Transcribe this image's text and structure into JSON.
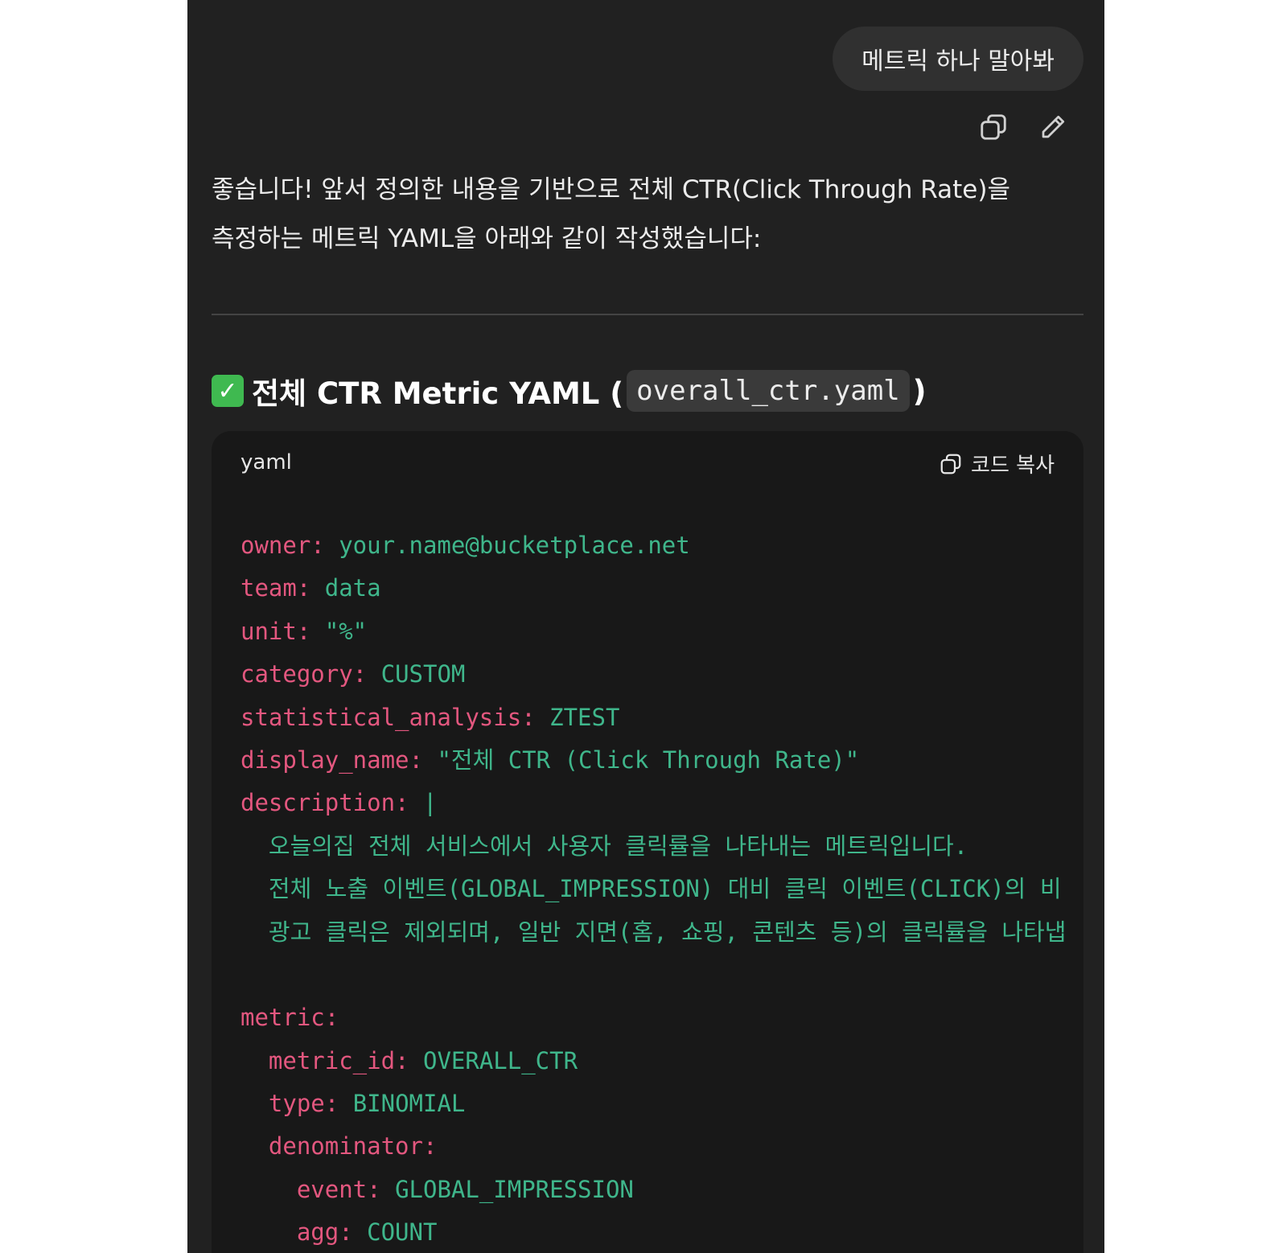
{
  "user_message": {
    "text": "메트릭 하나 말아봐"
  },
  "message_actions": {
    "copy_icon": "copy-icon",
    "edit_icon": "pencil-icon"
  },
  "assistant": {
    "intro_line1": "좋습니다! 앞서 정의한 내용을 기반으로 전체 CTR(Click Through Rate)을",
    "intro_line2": "측정하는 메트릭 YAML을 아래와 같이 작성했습니다:"
  },
  "section": {
    "heading_prefix": "전체 CTR Metric YAML (",
    "filename": "overall_ctr.yaml",
    "heading_suffix": ")"
  },
  "code_block": {
    "language": "yaml",
    "copy_label": "코드 복사",
    "lines": [
      {
        "key": "owner: ",
        "value": "your.name@bucketplace.net"
      },
      {
        "key": "team: ",
        "value": "data"
      },
      {
        "key": "unit: ",
        "value": "\"%\""
      },
      {
        "key": "category: ",
        "value": "CUSTOM"
      },
      {
        "key": "statistical_analysis: ",
        "value": "ZTEST"
      },
      {
        "key": "display_name: ",
        "value": "\"전체 CTR (Click Through Rate)\""
      },
      {
        "key": "description: ",
        "value": "|"
      },
      {
        "key": "",
        "value": "  오늘의집 전체 서비스에서 사용자 클릭률을 나타내는 메트릭입니다."
      },
      {
        "key": "",
        "value": "  전체 노출 이벤트(GLOBAL_IMPRESSION) 대비 클릭 이벤트(CLICK)의 비"
      },
      {
        "key": "",
        "value": "  광고 클릭은 제외되며, 일반 지면(홈, 쇼핑, 콘텐츠 등)의 클릭률을 나타냅"
      },
      {
        "key": "",
        "value": ""
      },
      {
        "key": "metric:",
        "value": ""
      },
      {
        "key": "  metric_id: ",
        "value": "OVERALL_CTR"
      },
      {
        "key": "  type: ",
        "value": "BINOMIAL"
      },
      {
        "key": "  denominator:",
        "value": ""
      },
      {
        "key": "    event: ",
        "value": "GLOBAL_IMPRESSION"
      },
      {
        "key": "    agg: ",
        "value": "COUNT"
      }
    ]
  }
}
